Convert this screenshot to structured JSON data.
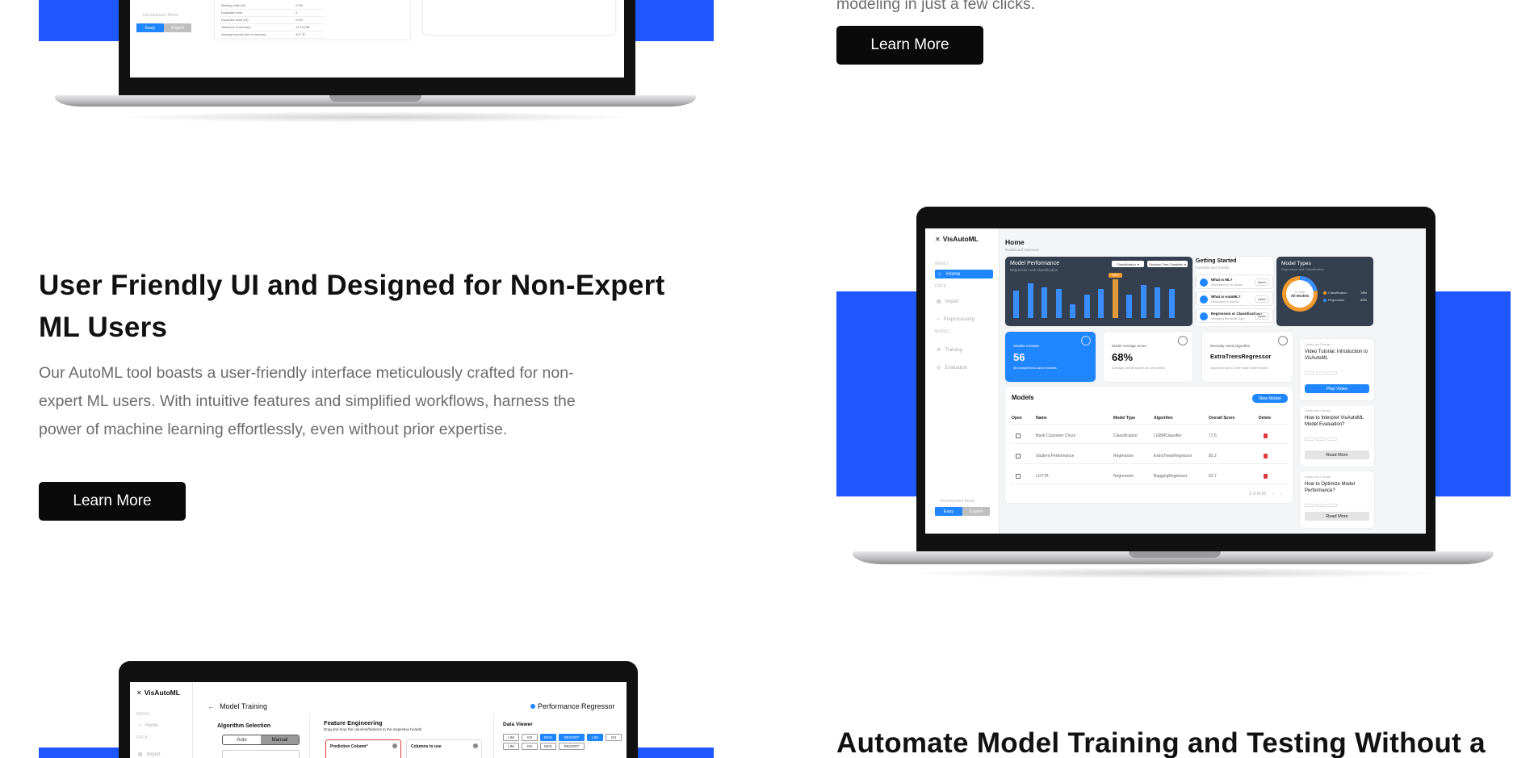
{
  "section_top": {
    "text_partial": "modeling in just a few clicks.",
    "learn_more": "Learn More",
    "screen": {
      "toggle_easy": "Easy",
      "toggle_expert": "Expert",
      "dev_mode": "Development Mode",
      "table_rows": [
        "Missing cells (%)",
        "Duplicate rows",
        "Duplicate rows (%)",
        "Total size in memory",
        "Average record size in memory"
      ],
      "table_vals": [
        "0.0%",
        "0",
        "0.0%",
        "473.6 KiB",
        "42.7 B"
      ]
    }
  },
  "section_middle": {
    "heading": "User Friendly UI and Designed for Non-Expert ML Users",
    "paragraph": "Our AutoML tool boasts a user-friendly interface meticulously crafted for non-expert ML users. With intuitive features and simplified workflows, harness the power of machine learning effortlessly, even without prior expertise.",
    "learn_more": "Learn More"
  },
  "app": {
    "logo": "VisAutoML",
    "menu_label": "MENU",
    "data_label": "DATA",
    "model_label": "MODEL",
    "nav": [
      "Home",
      "Import",
      "Preprocessing",
      "Training",
      "Evaluation"
    ],
    "dev_mode": "Development Mode",
    "toggle_easy": "Easy",
    "toggle_expert": "Expert",
    "page_title": "Home",
    "page_sub": "Dashboard Overview",
    "perf": {
      "title": "Model Performance",
      "sub": "Regression and Classification",
      "select1": "Classification",
      "select2": "Decision Tree Classifier",
      "highlight": "100%",
      "bars": [
        0.7,
        0.9,
        0.8,
        0.75,
        0.35,
        0.6,
        0.75,
        1.0,
        0.6,
        0.85,
        0.8,
        0.75
      ]
    },
    "getting_started": {
      "title": "Getting Started",
      "sub": "Tutorials and Guides",
      "items": [
        {
          "title": "What is ML?",
          "sub": "Introduction to ML Basics",
          "btn": "Open"
        },
        {
          "title": "What is AutoML?",
          "sub": "Introduction to AutoML",
          "btn": "Open"
        },
        {
          "title": "Regression or Classification?",
          "sub": "Identifying the Model Type",
          "btn": "Open"
        }
      ]
    },
    "model_types": {
      "title": "Model Types",
      "sub": "Regression and Classification",
      "center_top": "In Total",
      "center_main": "All Models",
      "legend": [
        {
          "name": "Classification",
          "pct": "78%",
          "color": "#f29a2e"
        },
        {
          "name": "Regression",
          "pct": "22%",
          "color": "#3a8dff"
        }
      ]
    },
    "stats": {
      "created_label": "Models Created",
      "created_value": "56",
      "created_sub": "46 completed & saved models",
      "avg_label": "Model Average Score",
      "avg_value": "68%",
      "avg_sub": "Average overall scores for all models",
      "algo_label": "Recently Used Algorithm",
      "algo_value": "ExtraTreesRegressor",
      "algo_sub": "Algorithm used in the most recent model"
    },
    "models": {
      "title": "Models",
      "new_btn": "New Model",
      "headers": [
        "Open",
        "Name",
        "Model Type",
        "Algorithm",
        "Overall Score",
        "Delete"
      ],
      "rows": [
        {
          "name": "Bank Customer Churn",
          "type": "Classification",
          "algo": "LGBMClassifier",
          "score": "77.6"
        },
        {
          "name": "Student Performance",
          "type": "Regression",
          "algo": "ExtraTreesRegressor",
          "score": "92.2"
        },
        {
          "name": "LOTTA",
          "type": "Regression",
          "algo": "BaggingRegressor",
          "score": "52.7"
        }
      ],
      "pagination": "1–3 of 10"
    },
    "tutorials": [
      {
        "kicker": "Guides and Tutorials",
        "title": "Video Tutorial: Introduction to VisAutoML",
        "btn": "Play Video"
      },
      {
        "kicker": "Guides and Tutorials",
        "title": "How to Interpret VisAutoML Model Evaluation?",
        "btn": "Read More"
      },
      {
        "kicker": "Guides and Tutorials",
        "title": "How to Optimize Model Performance?",
        "btn": "Read More"
      }
    ]
  },
  "section_bottom": {
    "heading": "Automate Model Training and Testing Without a",
    "app": {
      "logo": "VisAutoML",
      "menu_label": "MENU",
      "data_label": "DATA",
      "nav": [
        "Home",
        "Import"
      ],
      "back_title": "Model Training",
      "right_title": "Performance Regressor",
      "algo_section": "Algorithm Selection",
      "auto": "Auto",
      "manual": "Manual",
      "fe_title": "Feature Engineering",
      "fe_sub": "Drag and drop the columns/features to the respective boards",
      "prediction_col": "Prediction Column*",
      "columns_to_use": "Columns to use",
      "data_viewer": "Data Viewer",
      "chips_row1": [
        "LIM",
        "IOI",
        "MCK",
        "RESORT",
        "LIM",
        "IOI"
      ],
      "chips_row2": [
        "LIM",
        "IOI",
        "MCK",
        "RESORT"
      ]
    }
  }
}
